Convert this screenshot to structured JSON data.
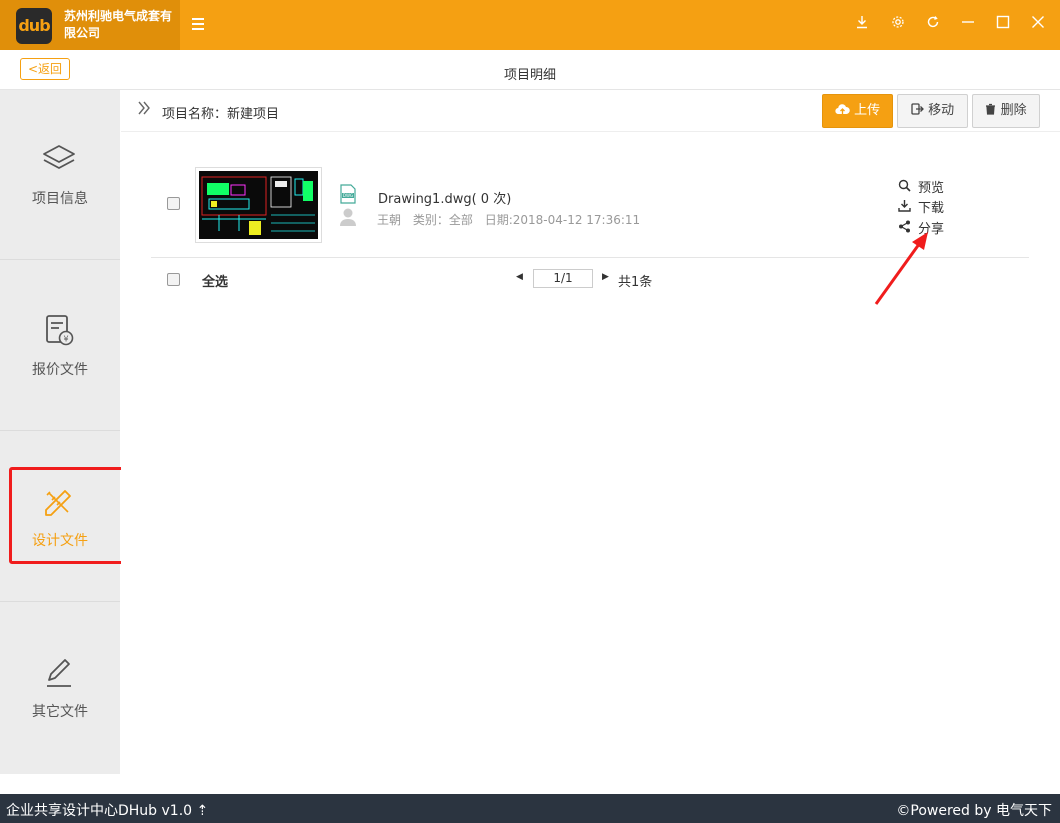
{
  "titlebar": {
    "logo_text": "dub",
    "company": "苏州利驰电气成套有限公司",
    "controls": [
      "download-icon",
      "settings-icon",
      "refresh-icon",
      "minimize-icon",
      "maximize-icon",
      "close-icon"
    ]
  },
  "subheader": {
    "back_label": "<返回",
    "title": "项目明细"
  },
  "sidebar": {
    "items": [
      {
        "label": "项目信息",
        "icon": "layers-icon"
      },
      {
        "label": "报价文件",
        "icon": "quote-document-icon"
      },
      {
        "label": "设计文件",
        "icon": "pencil-ruler-icon",
        "active": true
      },
      {
        "label": "其它文件",
        "icon": "pen-icon"
      }
    ]
  },
  "breadcrumb": {
    "label": "项目名称：新建项目"
  },
  "toolbar": {
    "upload_label": "上传",
    "move_label": "移动",
    "delete_label": "删除"
  },
  "files": [
    {
      "name": "Drawing1.dwg( 0 次)",
      "author": "王朝",
      "category": "类别：全部",
      "date": "日期:2018-04-12 17:36:11",
      "actions": {
        "preview": "预览",
        "download": "下载",
        "share": "分享"
      }
    }
  ],
  "list_footer": {
    "select_all": "全选",
    "page": "1/1",
    "total": "共1条"
  },
  "statusbar": {
    "left": "企业共享设计中心DHub v1.0 ⇡",
    "right": "©Powered by 电气天下"
  },
  "colors": {
    "accent": "#f5a012",
    "annotation": "#f01c1c",
    "statusbar": "#2b3440"
  }
}
